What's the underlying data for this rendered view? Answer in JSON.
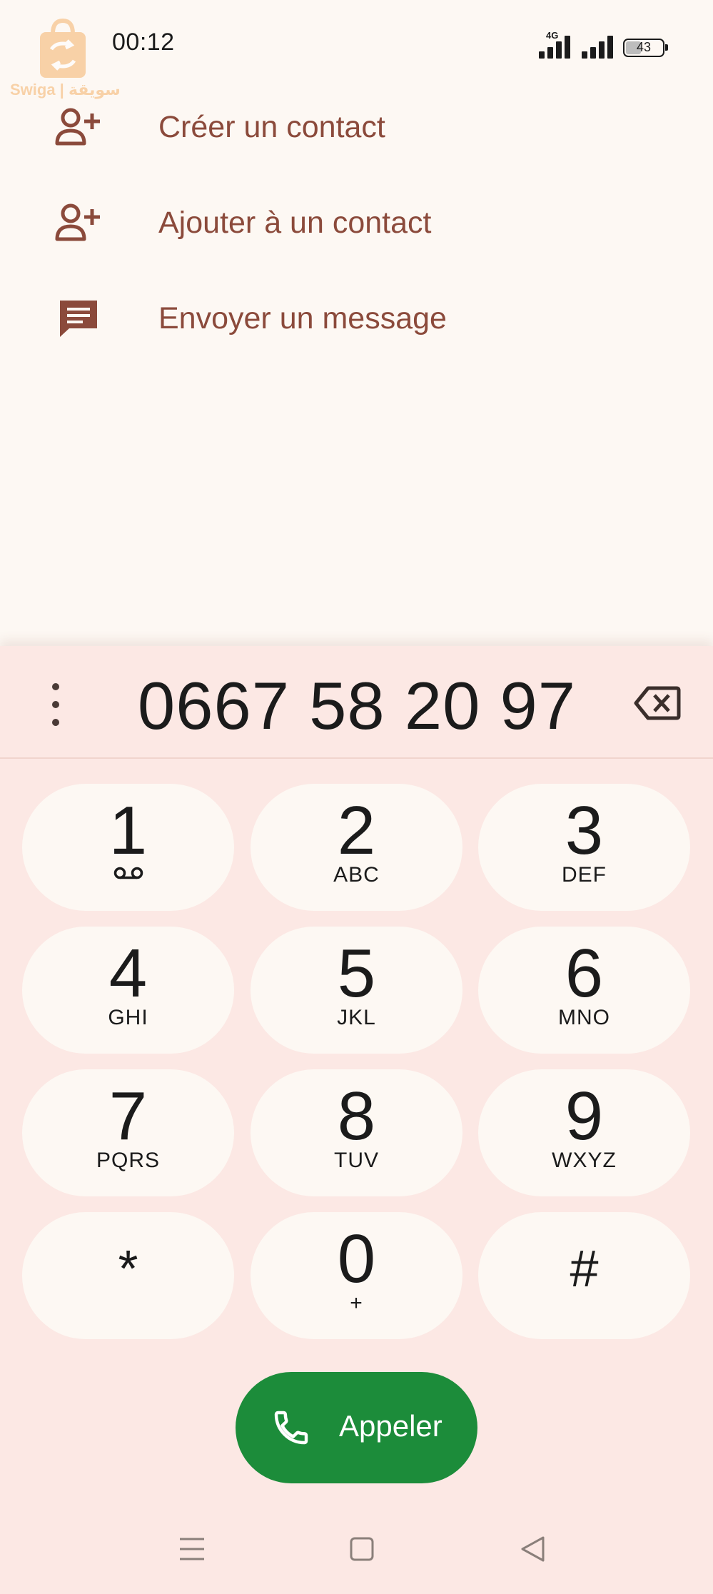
{
  "status_bar": {
    "time": "00:12",
    "network": "4G",
    "battery": "43",
    "battery_level": 0.43,
    "watermark": "Swiga | سويقة"
  },
  "actions": [
    {
      "label": "Créer un contact",
      "icon": "person-add-icon"
    },
    {
      "label": "Ajouter à un contact",
      "icon": "person-add-icon"
    },
    {
      "label": "Envoyer un message",
      "icon": "message-icon"
    }
  ],
  "dialer": {
    "number": "0667 58 20 97",
    "keys": [
      {
        "digit": "1",
        "letters": "",
        "icon": "voicemail-icon"
      },
      {
        "digit": "2",
        "letters": "ABC"
      },
      {
        "digit": "3",
        "letters": "DEF"
      },
      {
        "digit": "4",
        "letters": "GHI"
      },
      {
        "digit": "5",
        "letters": "JKL"
      },
      {
        "digit": "6",
        "letters": "MNO"
      },
      {
        "digit": "7",
        "letters": "PQRS"
      },
      {
        "digit": "8",
        "letters": "TUV"
      },
      {
        "digit": "9",
        "letters": "WXYZ"
      },
      {
        "digit": "*",
        "letters": ""
      },
      {
        "digit": "0",
        "letters": "+"
      },
      {
        "digit": "#",
        "letters": ""
      }
    ],
    "call_label": "Appeler"
  },
  "colors": {
    "background": "#fdf8f3",
    "panel": "#fce8e4",
    "action_text": "#8b4a3b",
    "call_button": "#1c8c3a"
  }
}
